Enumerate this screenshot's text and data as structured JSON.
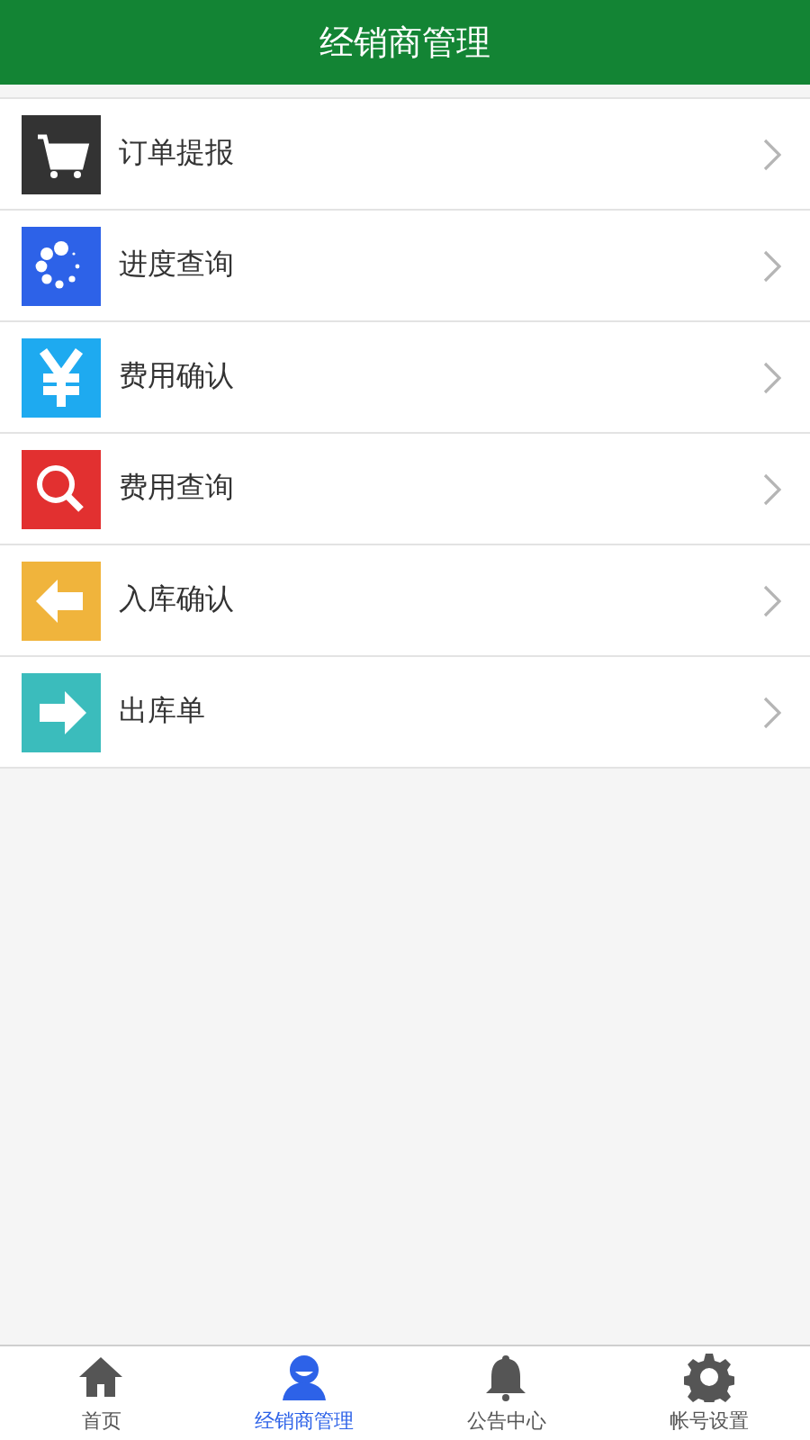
{
  "header": {
    "title": "经销商管理"
  },
  "menu": [
    {
      "label": "订单提报",
      "kind": "cart",
      "color": "#333333"
    },
    {
      "label": "进度查询",
      "kind": "spinner",
      "color": "#2d62e8"
    },
    {
      "label": "费用确认",
      "kind": "yen",
      "color": "#1eaaf0"
    },
    {
      "label": "费用查询",
      "kind": "search",
      "color": "#e23030"
    },
    {
      "label": "入库确认",
      "kind": "arrow-left",
      "color": "#f0b43c"
    },
    {
      "label": "出库单",
      "kind": "arrow-right",
      "color": "#3bbcbc"
    }
  ],
  "tabs": [
    {
      "label": "首页",
      "kind": "home",
      "selected": false
    },
    {
      "label": "经销商管理",
      "kind": "person",
      "selected": true
    },
    {
      "label": "公告中心",
      "kind": "bell",
      "selected": false
    },
    {
      "label": "帐号设置",
      "kind": "gear",
      "selected": false
    }
  ]
}
